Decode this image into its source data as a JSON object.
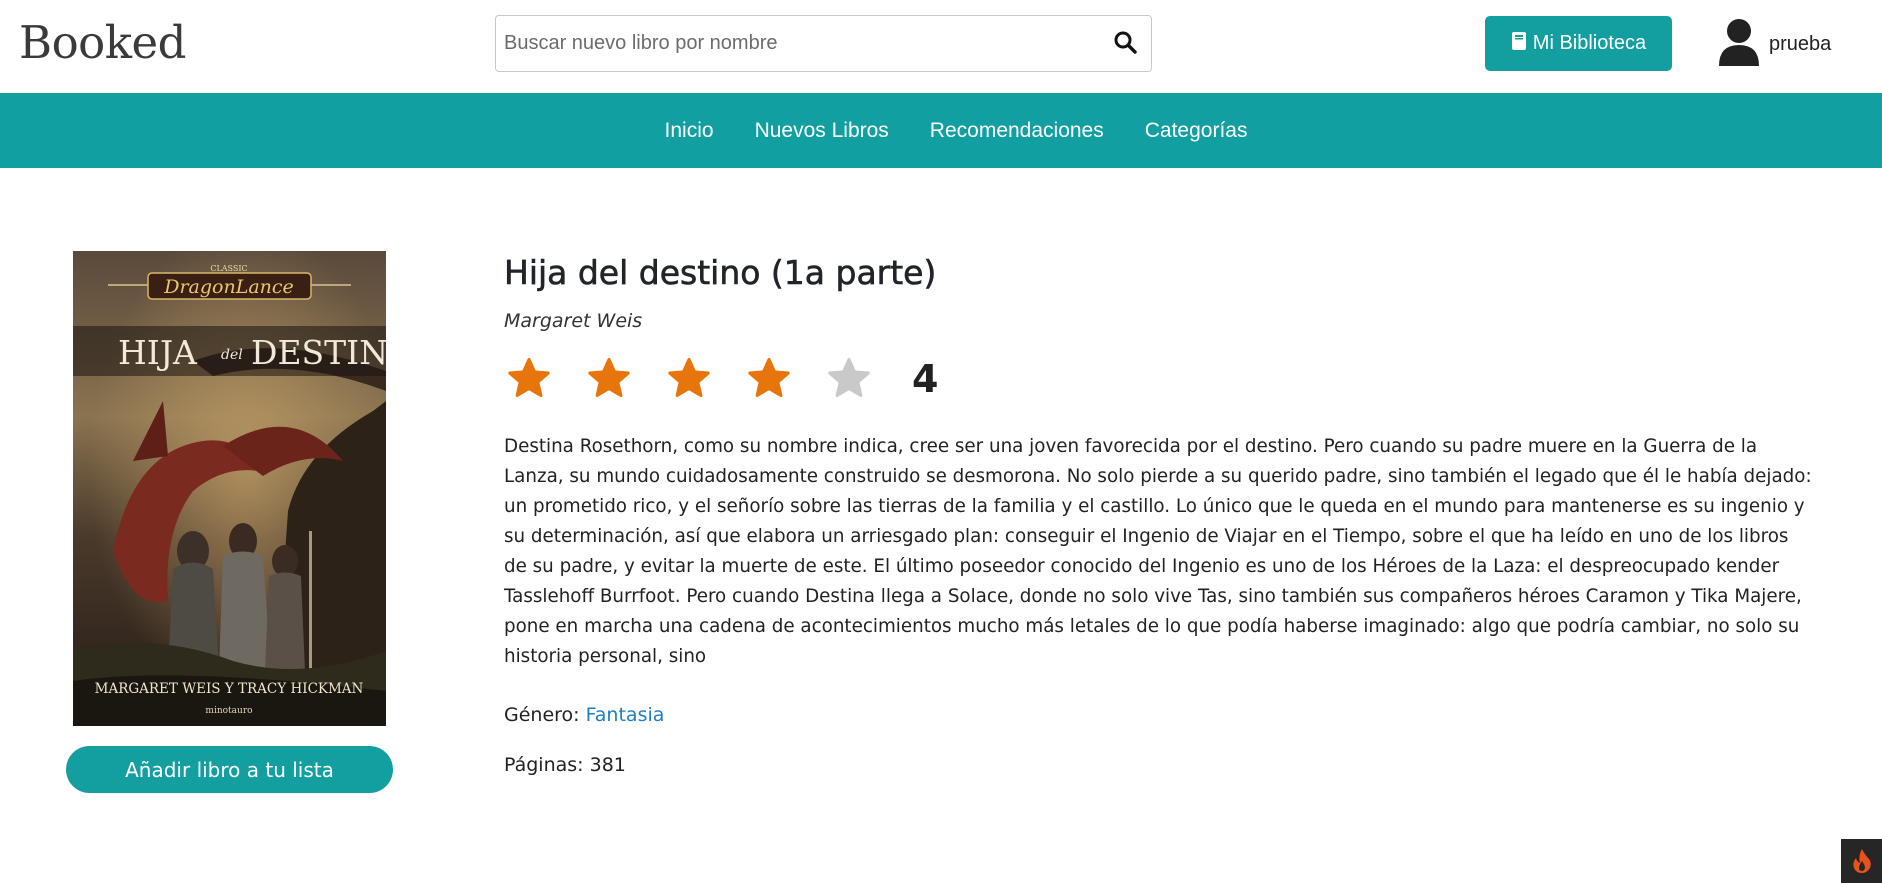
{
  "header": {
    "logo": "Booked",
    "search_placeholder": "Buscar nuevo libro por nombre",
    "library_button": "Mi Biblioteca",
    "username": "prueba"
  },
  "nav": {
    "items": [
      "Inicio",
      "Nuevos Libros",
      "Recomendaciones",
      "Categorías"
    ]
  },
  "book": {
    "cover": {
      "series_small": "CLASSIC",
      "series": "DragonLance",
      "title_left": "HIJA",
      "title_mid": "del",
      "title_right": "DESTINO",
      "authors": "MARGARET WEIS Y TRACY HICKMAN",
      "publisher": "minotauro"
    },
    "title": "Hija del destino (1a parte)",
    "author": "Margaret Weis",
    "rating": 4,
    "max_rating": 5,
    "rating_display": "4",
    "description": "Destina Rosethorn, como su nombre indica, cree ser una joven favorecida por el destino. Pero cuando su padre muere en la Guerra de la Lanza, su mundo cuidadosamente construido se desmorona. No solo pierde a su querido padre, sino también el legado que él le había dejado: un prometido rico, y el señorío sobre las tierras de la familia y el castillo. Lo único que le queda en el mundo para mantenerse es su ingenio y su determinación, así que elabora un arriesgado plan: conseguir el Ingenio de Viajar en el Tiempo, sobre el que ha leído en uno de los libros de su padre, y evitar la muerte de este. El último poseedor conocido del Ingenio es uno de los Héroes de la Laza: el despreocupado kender Tasslehoff Burrfoot. Pero cuando Destina llega a Solace, donde no solo vive Tas, sino también sus compañeros héroes Caramon y Tika Majere, pone en marcha una cadena de acontecimientos mucho más letales de lo que podía haberse imaginado: algo que podría cambiar, no solo su historia personal, sino",
    "genre_label": "Género: ",
    "genre": "Fantasia",
    "pages_label": "Páginas: ",
    "pages": "381",
    "add_button": "Añadir libro a tu lista"
  },
  "colors": {
    "accent": "#129fa1",
    "star_filled": "#e8740c",
    "star_empty": "#c9c9c9",
    "link": "#1f7fc6"
  }
}
